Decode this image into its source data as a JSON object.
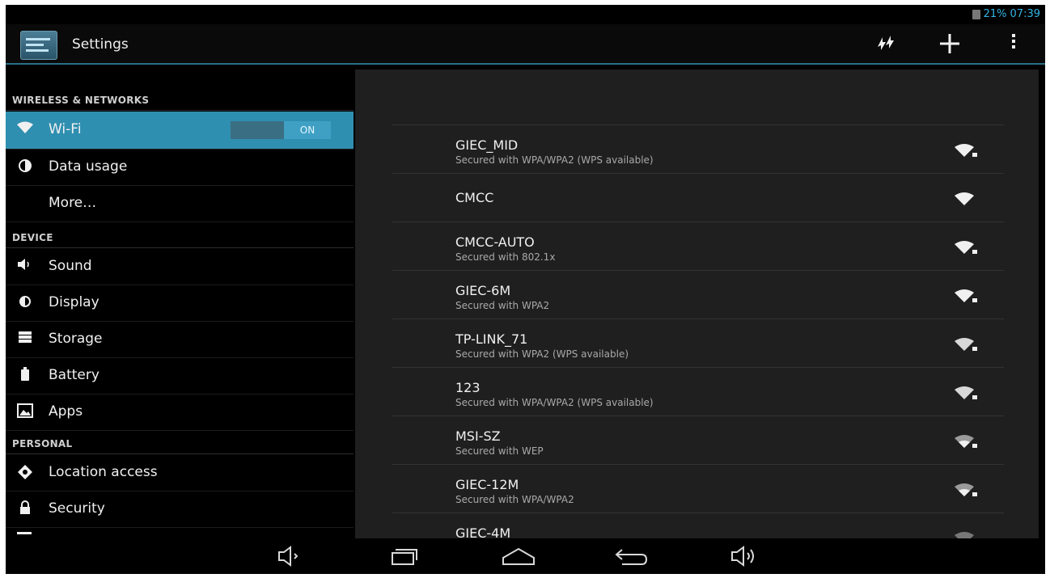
{
  "status_bar": {
    "battery": "21%",
    "time": "07:39"
  },
  "action_bar": {
    "title": "Settings",
    "actions": [
      "refresh-wps-icon",
      "add-icon",
      "overflow-menu-icon"
    ]
  },
  "sidebar": {
    "sections": {
      "wireless": "WIRELESS & NETWORKS",
      "device": "DEVICE",
      "personal": "PERSONAL"
    },
    "items": [
      {
        "label": "Wi-Fi",
        "icon": "wifi-icon",
        "selected": true,
        "toggle": "ON"
      },
      {
        "label": "Data usage",
        "icon": "data-usage-icon"
      },
      {
        "label": "More…",
        "icon": ""
      },
      {
        "label": "Sound",
        "icon": "sound-icon"
      },
      {
        "label": "Display",
        "icon": "display-icon"
      },
      {
        "label": "Storage",
        "icon": "storage-icon"
      },
      {
        "label": "Battery",
        "icon": "battery-icon"
      },
      {
        "label": "Apps",
        "icon": "apps-icon"
      },
      {
        "label": "Location access",
        "icon": "location-icon"
      },
      {
        "label": "Security",
        "icon": "lock-icon"
      }
    ]
  },
  "networks": [
    {
      "name": "GIEC_MID",
      "security": "Secured with WPA/WPA2 (WPS available)"
    },
    {
      "name": "CMCC",
      "security": ""
    },
    {
      "name": "CMCC-AUTO",
      "security": "Secured with 802.1x"
    },
    {
      "name": "GIEC-6M",
      "security": "Secured with WPA2"
    },
    {
      "name": "TP-LINK_71",
      "security": "Secured with WPA2 (WPS available)"
    },
    {
      "name": "123",
      "security": "Secured with WPA/WPA2 (WPS available)"
    },
    {
      "name": "MSI-SZ",
      "security": "Secured with WEP"
    },
    {
      "name": "GIEC-12M",
      "security": "Secured with WPA/WPA2"
    },
    {
      "name": "GIEC-4M",
      "security": ""
    }
  ],
  "nav_bar": [
    "volume-down-icon",
    "recent-apps-icon",
    "home-icon",
    "back-icon",
    "volume-up-icon"
  ],
  "colors": {
    "accent": "#33b5e5",
    "selected": "#2f8fb0",
    "pane": "#1f1f1f"
  }
}
